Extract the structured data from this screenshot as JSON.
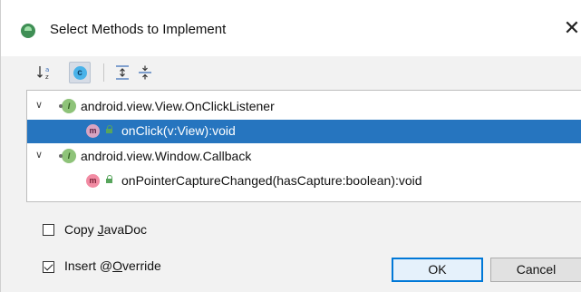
{
  "window": {
    "title": "Select Methods to Implement",
    "close_glyph": "✕"
  },
  "toolbar": {
    "sort_alpha_icon": "sort-alphabetically-icon",
    "sort_alpha_glyph": "↓ᵃᶻ",
    "show_classes_icon": "show-classes-icon",
    "show_classes_glyph": "c",
    "expand_all_icon": "expand-all-icon",
    "collapse_all_icon": "collapse-all-icon"
  },
  "tree": {
    "groups": [
      {
        "label": "android.view.View.OnClickListener",
        "icon": "interface-icon",
        "icon_glyph": "I",
        "expanded": true,
        "methods": [
          {
            "label": "onClick(v:View):void",
            "icon": "method-icon",
            "icon_glyph": "m",
            "selected": true
          }
        ]
      },
      {
        "label": "android.view.Window.Callback",
        "icon": "interface-icon",
        "icon_glyph": "I",
        "expanded": true,
        "methods": [
          {
            "label": "onPointerCaptureChanged(hasCapture:boolean):void",
            "icon": "method-icon",
            "icon_glyph": "m",
            "selected": false
          }
        ]
      }
    ],
    "expanded_glyph": "∨"
  },
  "options": {
    "copy_javadoc": {
      "label_pre": "Copy ",
      "label_mnemonic": "J",
      "label_post": "avaDoc",
      "checked": false
    },
    "insert_override": {
      "label_pre": "Insert @",
      "label_mnemonic": "O",
      "label_post": "verride",
      "checked": true
    }
  },
  "buttons": {
    "ok": "OK",
    "cancel": "Cancel"
  },
  "colors": {
    "selection": "#2675bf",
    "default_button_border": "#0078d7",
    "interface_icon": "#8ec379",
    "method_icon": "#f28ba3",
    "class_icon": "#49b2e9"
  }
}
